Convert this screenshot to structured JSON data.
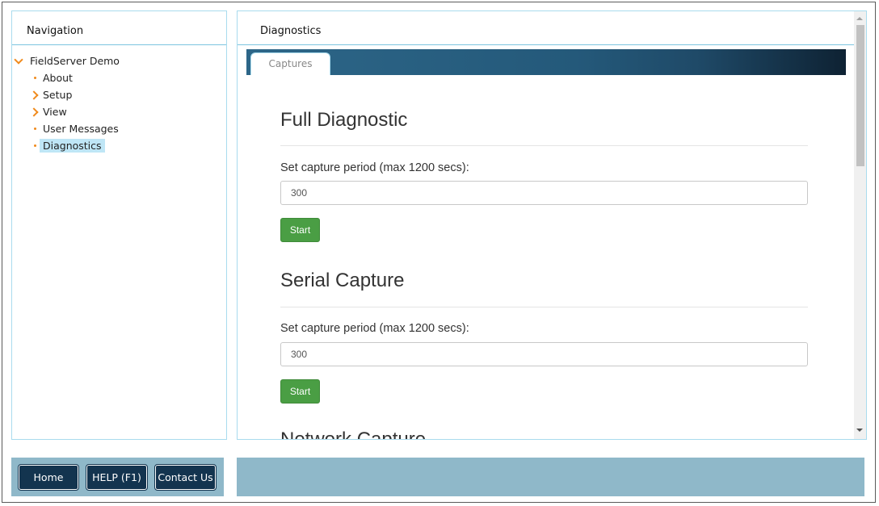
{
  "navigation": {
    "title": "Navigation",
    "tree": {
      "root": "FieldServer Demo",
      "items": [
        "About",
        "Setup",
        "View",
        "User Messages",
        "Diagnostics"
      ]
    }
  },
  "diagnostics": {
    "title": "Diagnostics",
    "tab": "Captures",
    "sections": [
      {
        "title": "Full Diagnostic",
        "label": "Set capture period (max 1200 secs):",
        "value": "300",
        "button": "Start"
      },
      {
        "title": "Serial Capture",
        "label": "Set capture period (max 1200 secs):",
        "value": "300",
        "button": "Start"
      },
      {
        "title": "Network Capture"
      }
    ]
  },
  "footer": {
    "buttons": [
      "Home",
      "HELP (F1)",
      "Contact Us"
    ]
  },
  "colors": {
    "accent_orange": "#f08a1c",
    "button_dark": "#13344f",
    "start_green": "#4a9e44",
    "bar_blue": "#8fb8c9",
    "selected_bg": "#bfe6f6"
  }
}
